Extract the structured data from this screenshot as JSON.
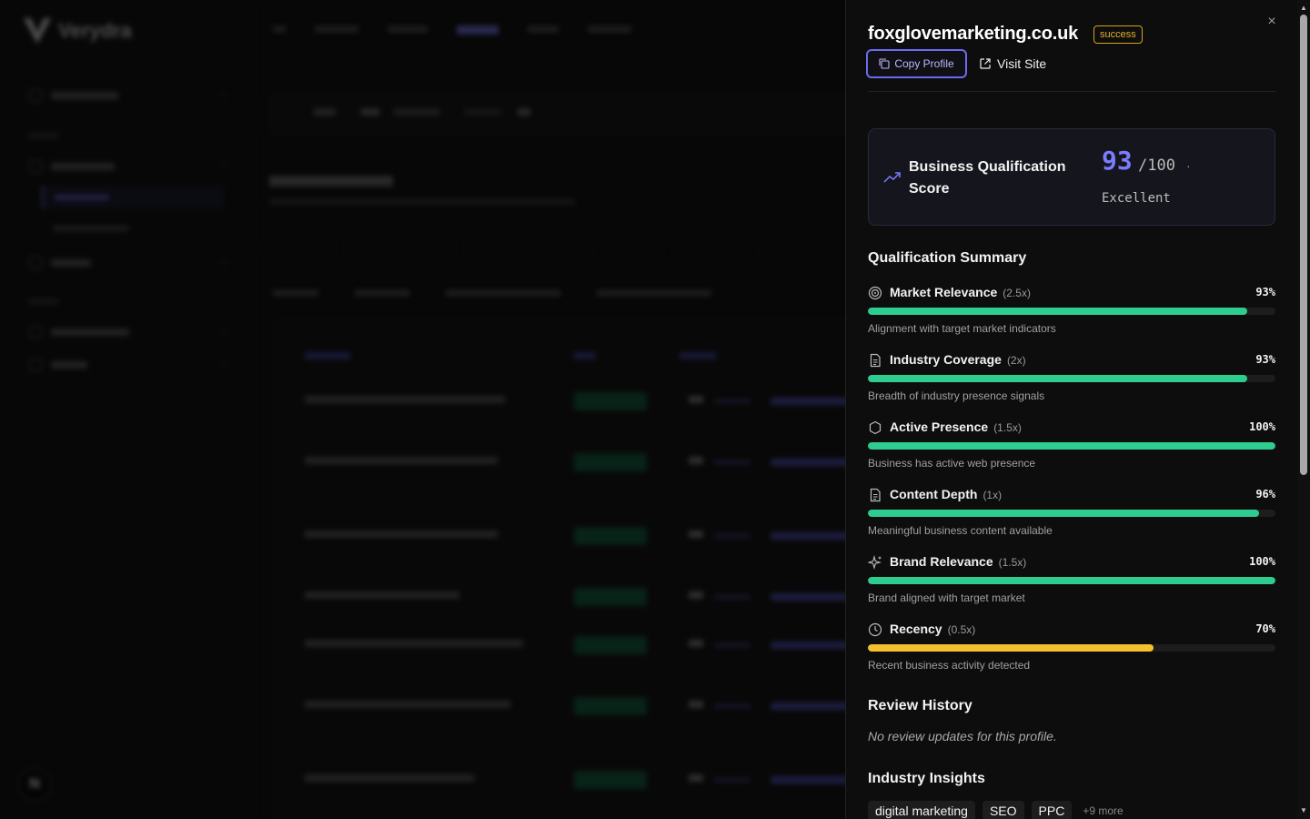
{
  "panel": {
    "domain": "foxglovemarketing.co.uk",
    "status": "success",
    "status_color": "#e3b02a",
    "copy_label": "Copy Profile",
    "visit_label": "Visit Site",
    "close_icon": "×",
    "score": {
      "label": "Business Qualification Score",
      "value": "93",
      "max": "/100",
      "dot": "·",
      "grade": "Excellent",
      "accent": "#7b7bff"
    },
    "summary_title": "Qualification Summary",
    "metrics": [
      {
        "name": "Market Relevance",
        "weight": "(2.5x)",
        "pct": "93%",
        "fill": 0.93,
        "color": "#2ecc8f",
        "desc": "Alignment with target market indicators",
        "icon": "target-icon"
      },
      {
        "name": "Industry Coverage",
        "weight": "(2x)",
        "pct": "93%",
        "fill": 0.93,
        "color": "#2ecc8f",
        "desc": "Breadth of industry presence signals",
        "icon": "document-icon"
      },
      {
        "name": "Active Presence",
        "weight": "(1.5x)",
        "pct": "100%",
        "fill": 1.0,
        "color": "#2ecc8f",
        "desc": "Business has active web presence",
        "icon": "hexagon-icon"
      },
      {
        "name": "Content Depth",
        "weight": "(1x)",
        "pct": "96%",
        "fill": 0.96,
        "color": "#2ecc8f",
        "desc": "Meaningful business content available",
        "icon": "document-icon"
      },
      {
        "name": "Brand Relevance",
        "weight": "(1.5x)",
        "pct": "100%",
        "fill": 1.0,
        "color": "#2ecc8f",
        "desc": "Brand aligned with target market",
        "icon": "sparkle-icon"
      },
      {
        "name": "Recency",
        "weight": "(0.5x)",
        "pct": "70%",
        "fill": 0.7,
        "color": "#f5c030",
        "desc": "Recent business activity detected",
        "icon": "clock-icon"
      }
    ],
    "history_title": "Review History",
    "history_note": "No review updates for this profile.",
    "insights_title": "Industry Insights",
    "tags": [
      "digital marketing",
      "SEO",
      "PPC"
    ],
    "tags_more": "+9 more"
  },
  "background": {
    "brand": "Verydra",
    "avatar_initial": "N"
  }
}
